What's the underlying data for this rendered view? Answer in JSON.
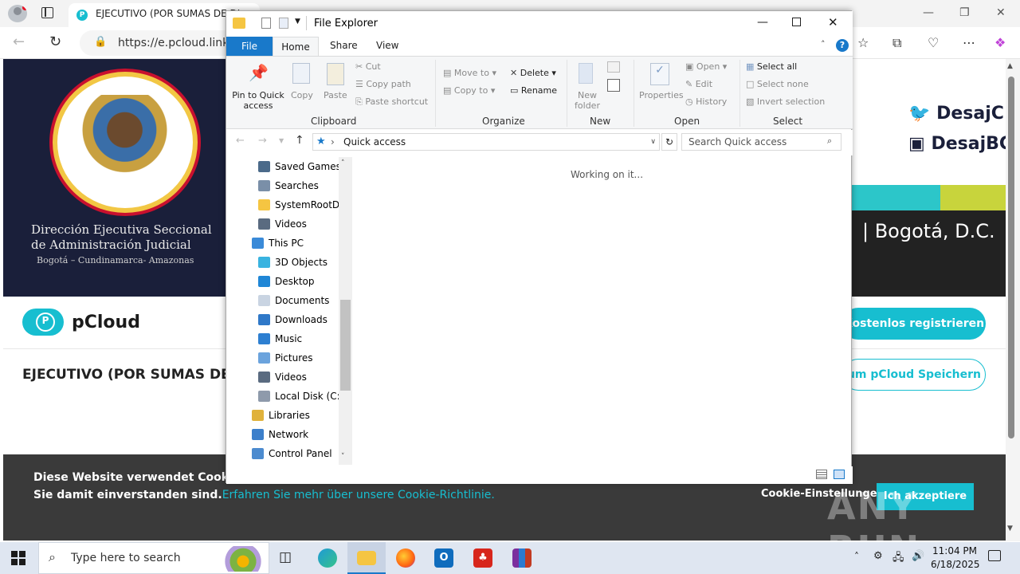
{
  "browser": {
    "tab_title": "EJECUTIVO (POR SUMAS DE DI",
    "tab_favicon": "P",
    "url": "https://e.pcloud.link/p"
  },
  "page": {
    "banner_title": "Dirección Ejecutiva Seccional de Administración Judicial",
    "banner_subtitle": "Bogotá – Cundinamarca- Amazonas",
    "twitter_handle": "DesajC",
    "insta_handle": "DesajBC",
    "city": "| Bogotá, D.C.",
    "brand_name": "pCloud",
    "file_title": "EJECUTIVO (POR SUMAS DE DI",
    "register_button": "Kostenlos registrieren",
    "save_button": "um pCloud Speichern",
    "colors": {
      "accent": "#17bed0",
      "cookie_bg": "#3a3a3a",
      "banner": "#1a1f3a"
    }
  },
  "cookie": {
    "text": "Diese Website verwendet Cookies, um Informationen zu sammeln. Die Nutzung dieser Website bedeutet, dass Sie damit einverstanden sind.",
    "link": "Erfahren Sie mehr über unsere Cookie-Richtlinie.",
    "settings": "Cookie-Einstellungen",
    "accept": "Ich akzeptiere"
  },
  "watermark": "ANY RUN",
  "explorer": {
    "title": "File Explorer",
    "tabs": [
      "File",
      "Home",
      "Share",
      "View"
    ],
    "clipboard": {
      "pin": "Pin to Quick access",
      "copy": "Copy",
      "paste": "Paste",
      "cut": "Cut",
      "copy_path": "Copy path",
      "paste_shortcut": "Paste shortcut",
      "group": "Clipboard"
    },
    "organize": {
      "move_to": "Move to",
      "copy_to": "Copy to",
      "delete": "Delete",
      "rename": "Rename",
      "group": "Organize"
    },
    "new": {
      "new_folder": "New folder",
      "group": "New"
    },
    "open": {
      "properties": "Properties",
      "open": "Open",
      "edit": "Edit",
      "history": "History",
      "group": "Open"
    },
    "select": {
      "all": "Select all",
      "none": "Select none",
      "invert": "Invert selection",
      "group": "Select"
    },
    "address": "Quick access",
    "search_placeholder": "Search Quick access",
    "status": "Working on it...",
    "tree": [
      {
        "label": "Saved Games",
        "icon": "saved-games-icon"
      },
      {
        "label": "Searches",
        "icon": "searches-icon"
      },
      {
        "label": "SystemRootDo",
        "icon": "folder-icon"
      },
      {
        "label": "Videos",
        "icon": "videos-icon"
      },
      {
        "label": "This PC",
        "icon": "this-pc-icon"
      },
      {
        "label": "3D Objects",
        "icon": "3d-objects-icon"
      },
      {
        "label": "Desktop",
        "icon": "desktop-icon"
      },
      {
        "label": "Documents",
        "icon": "documents-icon"
      },
      {
        "label": "Downloads",
        "icon": "downloads-icon"
      },
      {
        "label": "Music",
        "icon": "music-icon"
      },
      {
        "label": "Pictures",
        "icon": "pictures-icon"
      },
      {
        "label": "Videos",
        "icon": "videos-icon"
      },
      {
        "label": "Local Disk (C:)",
        "icon": "local-disk-icon"
      },
      {
        "label": "Libraries",
        "icon": "libraries-icon"
      },
      {
        "label": "Network",
        "icon": "network-icon"
      },
      {
        "label": "Control Panel",
        "icon": "control-panel-icon"
      }
    ]
  },
  "taskbar": {
    "search_placeholder": "Type here to search",
    "time": "11:04 PM",
    "date": "6/18/2025"
  }
}
